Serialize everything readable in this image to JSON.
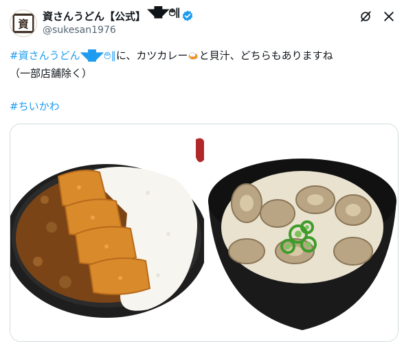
{
  "post": {
    "author": {
      "display_name": "資さんうどん【公式】",
      "kaomoji": "◥█̆̈◤࿉∥",
      "handle": "@sukesan1976",
      "avatar_glyph": "資",
      "verified": true
    },
    "actions": [
      "grok-icon",
      "close-icon"
    ],
    "text": {
      "line1_hashtag": "#資さんうどん",
      "line1_kaomoji": "◥█̆̈◤࿉∥",
      "line1_a": "に、カツカレー",
      "line1_emoji": "🍛",
      "line1_b": "と貝汁、どちらもありますね",
      "line2": "（一部店舗除く）",
      "hashtag2": "#ちいかわ"
    },
    "media": [
      {
        "alt": "katsu-curry-photo"
      },
      {
        "alt": "clam-soup-photo"
      }
    ],
    "colors": {
      "link": "#1d9bf0",
      "text": "#0f1419",
      "secondary": "#536471",
      "border": "#cfd9de"
    }
  }
}
